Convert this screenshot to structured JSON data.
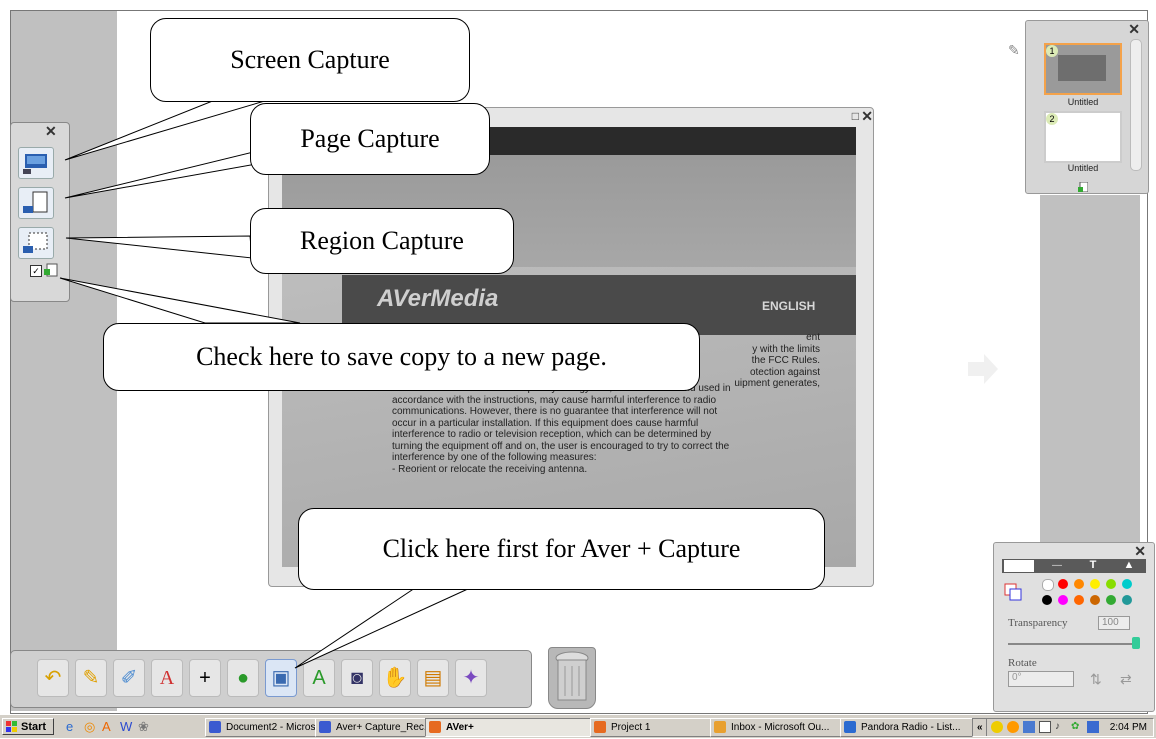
{
  "callouts": {
    "screen_capture": "Screen Capture",
    "page_capture": "Page Capture",
    "region_capture": "Region Capture",
    "new_page_note": "Check here to save copy to a new page.",
    "aver_capture_note": "Click here first for Aver + Capture"
  },
  "document": {
    "brand": "AVerMedia",
    "language": "ENGLISH",
    "partial_lines": [
      "ent",
      "y with the limits",
      "the FCC Rules.",
      "otection against",
      "uipment generates,"
    ],
    "body_lines": [
      "uses and can radiate radio frequency energy and, if not installed and used in",
      "accordance with the instructions, may cause harmful interference to radio",
      "communications.  However, there is no guarantee that interference will not",
      "occur in a particular installation.  If this equipment does cause harmful",
      "interference to radio or television reception, which can be determined by",
      "turning the equipment off and on, the user is encouraged to try to correct the",
      "interference by one of the following measures:",
      "-   Reorient or relocate the receiving antenna."
    ]
  },
  "thumbnails": [
    {
      "number": "1",
      "label": "Untitled"
    },
    {
      "number": "2",
      "label": "Untitled"
    }
  ],
  "palette": {
    "transparency_label": "Transparency",
    "transparency_value": "100",
    "rotate_label": "Rotate",
    "rotate_value": "0°",
    "tab_text_label": "T"
  },
  "taskbar": {
    "start_label": "Start",
    "tasks": [
      {
        "label": "Document2 - Micros..."
      },
      {
        "label": "Aver+ Capture_Rec..."
      },
      {
        "label": "AVer+"
      },
      {
        "label": "Project 1"
      },
      {
        "label": "Inbox - Microsoft Ou..."
      },
      {
        "label": "Pandora Radio - List..."
      }
    ],
    "tray_chevron": "«",
    "clock": "2:04 PM"
  },
  "colors": {
    "capture_panel_bg": "#d8d8d8",
    "selected_thumb_border": "#f4a24a",
    "taskbar_bg": "#d4d0c8",
    "palette_colors": [
      "#ff0000",
      "#ff8800",
      "#ffee00",
      "#88dd00",
      "#00cccc",
      "#ff00ff",
      "#ff6600",
      "#cc6600",
      "#33aa33",
      "#229999",
      "#000000",
      "#ffffff"
    ]
  }
}
